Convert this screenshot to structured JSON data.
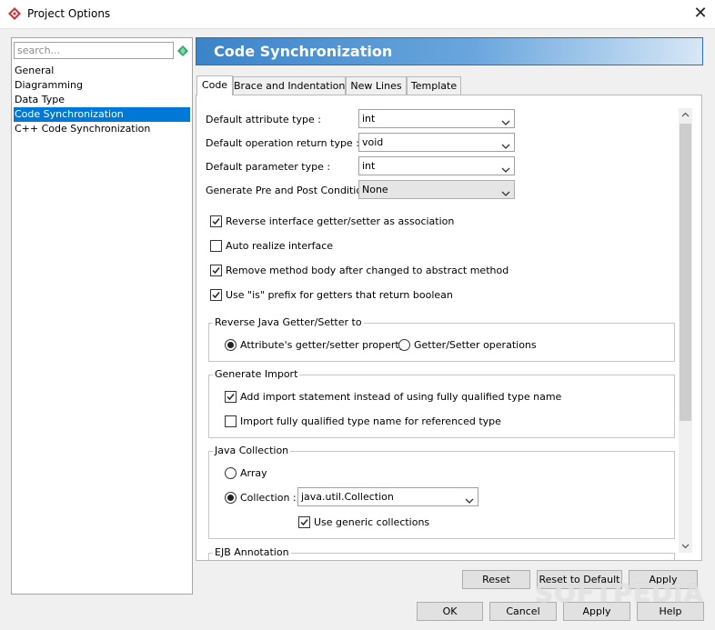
{
  "window": {
    "title": "Project Options",
    "close_glyph": "✕"
  },
  "sidebar": {
    "search_placeholder": "search...",
    "items": [
      {
        "label": "General"
      },
      {
        "label": "Diagramming"
      },
      {
        "label": "Data Type"
      },
      {
        "label": "Code Synchronization",
        "selected": true
      },
      {
        "label": "C++ Code Synchronization"
      }
    ]
  },
  "header": {
    "title": "Code Synchronization"
  },
  "tabs": [
    {
      "label": "Code",
      "active": true
    },
    {
      "label": "Brace and Indentation"
    },
    {
      "label": "New Lines"
    },
    {
      "label": "Template"
    }
  ],
  "form": {
    "default_attribute_type": {
      "label": "Default attribute type :",
      "value": "int"
    },
    "default_operation_return_type": {
      "label": "Default operation return type :",
      "value": "void"
    },
    "default_parameter_type": {
      "label": "Default parameter type :",
      "value": "int"
    },
    "generate_pre_post_condition": {
      "label": "Generate Pre and Post Condition :",
      "value": "None"
    }
  },
  "checkboxes": {
    "reverse_interface": {
      "label": "Reverse interface getter/setter as association",
      "checked": true
    },
    "auto_realize": {
      "label": "Auto realize interface",
      "checked": false
    },
    "remove_method_body": {
      "label": "Remove method body after changed to abstract method",
      "checked": true
    },
    "use_is_prefix": {
      "label": "Use \"is\" prefix for getters that return boolean",
      "checked": true
    }
  },
  "reverse_java_group": {
    "title": "Reverse Java Getter/Setter to",
    "option_attribute": {
      "label": "Attribute's getter/setter property",
      "selected": true
    },
    "option_operations": {
      "label": "Getter/Setter operations",
      "selected": false
    }
  },
  "generate_import_group": {
    "title": "Generate Import",
    "add_import": {
      "label": "Add import statement instead of using fully qualified type name",
      "checked": true
    },
    "import_fully_qualified": {
      "label": "Import fully qualified type name for referenced type",
      "checked": false
    }
  },
  "java_collection_group": {
    "title": "Java Collection",
    "option_array": {
      "label": "Array",
      "selected": false
    },
    "option_collection": {
      "label": "Collection :",
      "selected": true
    },
    "collection_value": "java.util.Collection",
    "use_generic": {
      "label": "Use generic collections",
      "checked": true
    }
  },
  "ejb_group": {
    "title": "EJB Annotation"
  },
  "panel_buttons": {
    "reset": "Reset",
    "reset_default": "Reset to Default",
    "apply": "Apply"
  },
  "dialog_buttons": {
    "ok": "OK",
    "cancel": "Cancel",
    "apply": "Apply",
    "help": "Help"
  },
  "watermark": "SOFTPEDIA",
  "colors": {
    "accent": "#0078d7",
    "header_start": "#3b84c9",
    "header_end": "#d7e7f6",
    "gem": "#2aa66b",
    "app_icon": "#c9353a"
  }
}
